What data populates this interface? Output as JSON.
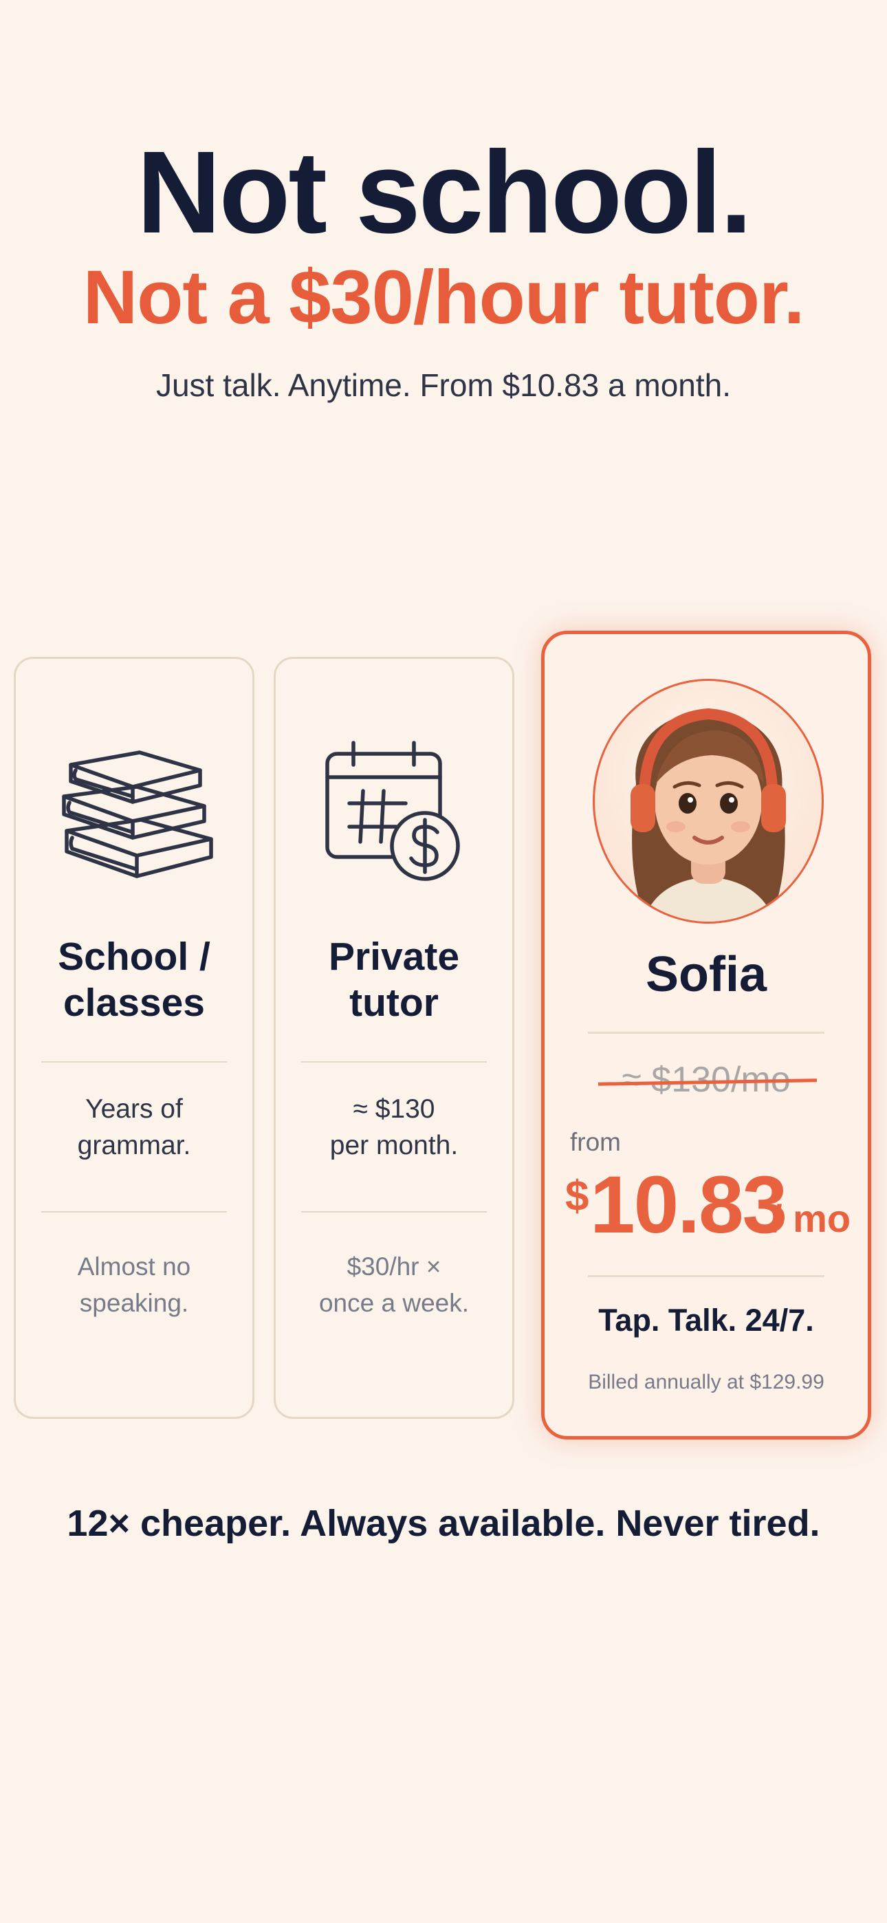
{
  "hero": {
    "title_line1": "Not school.",
    "title_line2": "Not a $30/hour tutor.",
    "subtitle": "Just talk. Anytime. From $10.83 a month."
  },
  "cards": {
    "school": {
      "icon": "books-icon",
      "title_line1": "School /",
      "title_line2": "classes",
      "point1_line1": "Years of",
      "point1_line2": "grammar.",
      "point2_line1": "Almost no",
      "point2_line2": "speaking."
    },
    "tutor": {
      "icon": "calendar-dollar-icon",
      "title_line1": "Private",
      "title_line2": "tutor",
      "point1_line1": "≈ $130",
      "point1_line2": "per month.",
      "point2_line1": "$30/hr ×",
      "point2_line2": "once a week."
    },
    "sofia": {
      "avatar": "sofia-avatar",
      "name": "Sofia",
      "old_price": "≈ $130/mo",
      "from_label": "from",
      "price_currency": "$",
      "price_value": "10.83",
      "price_unit": "/ mo",
      "tagline": "Tap. Talk. 24/7.",
      "billing_note": "Billed annually at $129.99"
    }
  },
  "footer": {
    "text": "12× cheaper. Always available. Never tired."
  },
  "colors": {
    "background": "#FCF3EB",
    "navy": "#141C36",
    "accent": "#E8623F",
    "card_border": "#E5D6C6"
  }
}
